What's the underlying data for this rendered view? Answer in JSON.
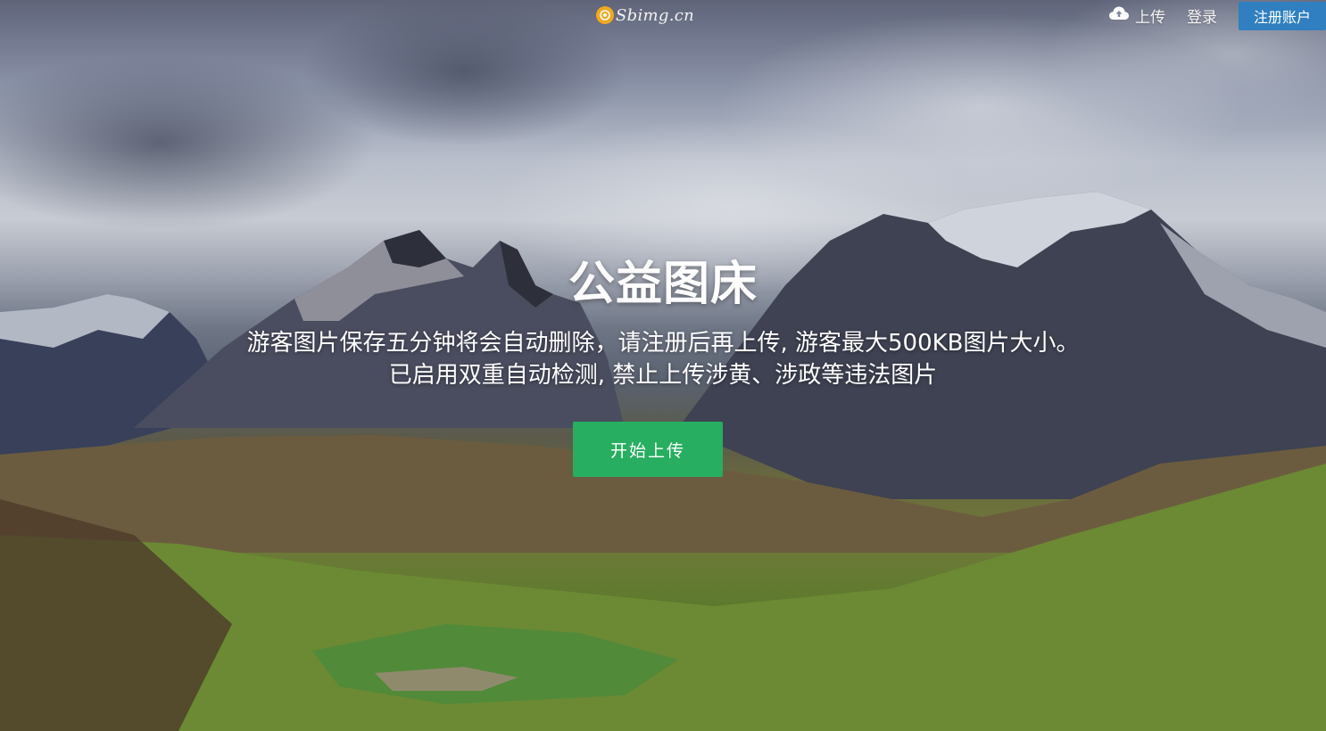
{
  "logo": {
    "text": "Sbimg.cn"
  },
  "nav": {
    "upload_label": "上传",
    "login_label": "登录",
    "register_label": "注册账户"
  },
  "hero": {
    "title": "公益图床",
    "description_line1": "游客图片保存五分钟将会自动删除，请注册后再上传, 游客最大500KB图片大小。",
    "description_line2": "已启用双重自动检测, 禁止上传涉黄、涉政等违法图片",
    "start_button_label": "开始上传"
  },
  "icons": {
    "logo_badge": "logo-badge-icon",
    "upload": "cloud-upload-icon"
  },
  "colors": {
    "register_button": "#2f7fc1",
    "start_button": "#27ae60",
    "logo_badge": "#f3a81c",
    "text": "#ffffff"
  }
}
